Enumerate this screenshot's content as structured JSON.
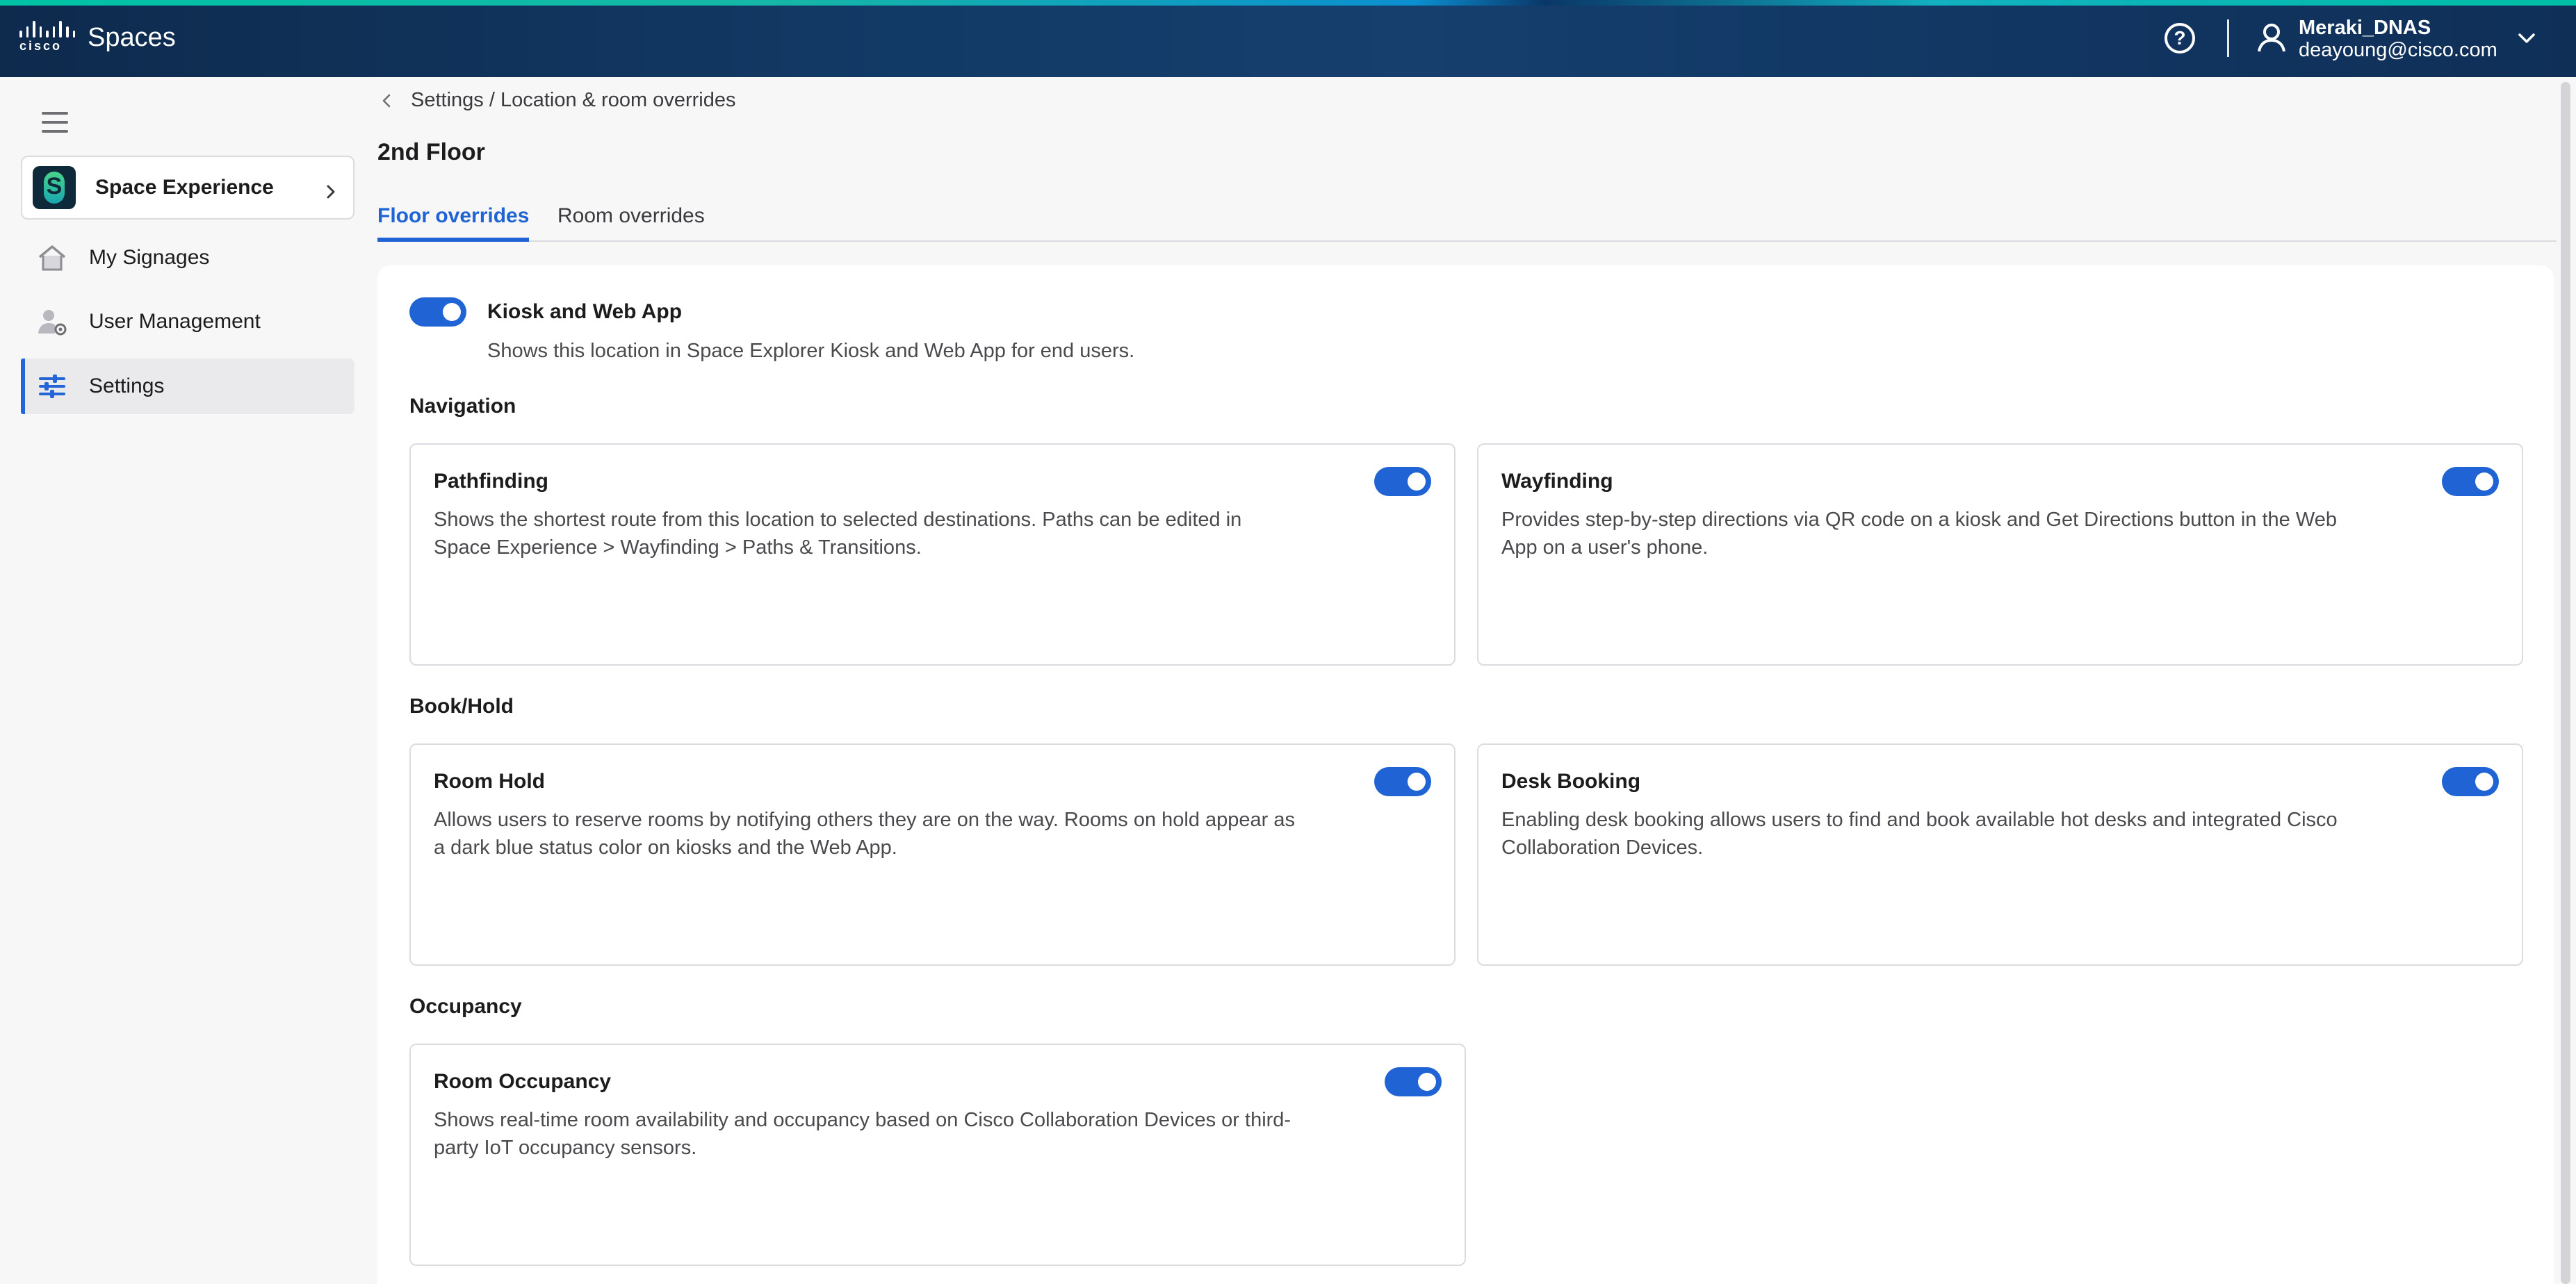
{
  "header": {
    "brand_word": "cisco",
    "app_name": "Spaces",
    "user_name": "Meraki_DNAS",
    "user_email": "deayoung@cisco.com",
    "icons": [
      "help-icon",
      "user-icon",
      "chevron-down-icon"
    ]
  },
  "sidebar": {
    "space_selector": "Space Experience",
    "items": [
      {
        "label": "My Signages",
        "icon": "home-icon",
        "active": false
      },
      {
        "label": "User Management",
        "icon": "user-settings-icon",
        "active": false
      },
      {
        "label": "Settings",
        "icon": "sliders-icon",
        "active": true
      }
    ]
  },
  "main": {
    "breadcrumb": "Settings / Location & room overrides",
    "title": "2nd Floor",
    "tabs": [
      {
        "label": "Floor overrides",
        "active": true
      },
      {
        "label": "Room overrides",
        "active": false
      }
    ],
    "kiosk": {
      "title": "Kiosk and Web App",
      "description": "Shows this location in Space Explorer Kiosk and Web App for end users.",
      "enabled": true
    },
    "sections": {
      "navigation": "Navigation",
      "bookhold": "Book/Hold",
      "occupancy": "Occupancy"
    },
    "cards": {
      "pathfinding": {
        "title": "Pathfinding",
        "description": "Shows the shortest route from this location to selected destinations. Paths can be edited in Space Experience > Wayfinding > Paths & Transitions.",
        "enabled": true
      },
      "wayfinding": {
        "title": "Wayfinding",
        "description": "Provides step-by-step directions via QR code on a kiosk and Get Directions button in the Web App on a user's phone.",
        "enabled": true
      },
      "room_hold": {
        "title": "Room Hold",
        "description": "Allows users to reserve rooms by notifying others they are on the way. Rooms on hold appear as a dark blue status color on kiosks and the Web App.",
        "enabled": true
      },
      "desk_booking": {
        "title": "Desk Booking",
        "description": "Enabling desk booking allows users to find and book available hot desks and integrated Cisco Collaboration Devices.",
        "enabled": true
      },
      "room_occupancy": {
        "title": "Room Occupancy",
        "description": "Shows real-time room availability and occupancy based on Cisco Collaboration Devices or third-party IoT occupancy sensors.",
        "enabled": true
      }
    }
  },
  "colors": {
    "accent_blue": "#1f63d4",
    "header_navy": "#123a66",
    "header_accent": "#00c3a5"
  }
}
